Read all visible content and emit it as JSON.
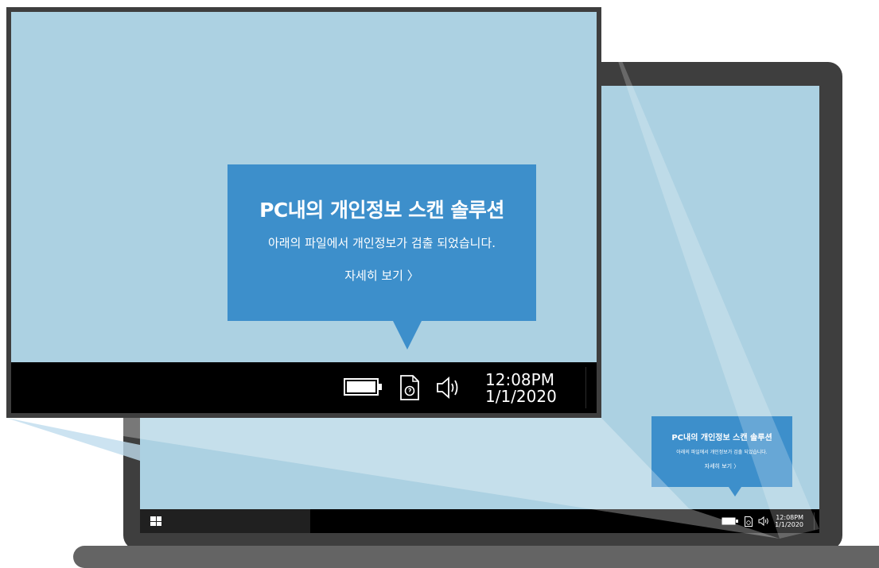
{
  "popup": {
    "title": "PC내의 개인정보 스캔 솔루션",
    "message": "아래의 파일에서 개인정보가 검출 되었습니다.",
    "link": "자세히 보기 〉"
  },
  "tray": {
    "time": "12:08PM",
    "date": "1/1/2020",
    "icons": [
      "battery-icon",
      "document-scan-icon",
      "speaker-icon"
    ]
  },
  "taskbar": {
    "start_icon": "windows-logo-icon"
  },
  "colors": {
    "desktop": "#acd1e2",
    "popup": "#3d8fcb",
    "taskbar": "#000000",
    "bezel": "#3e3e3e"
  }
}
